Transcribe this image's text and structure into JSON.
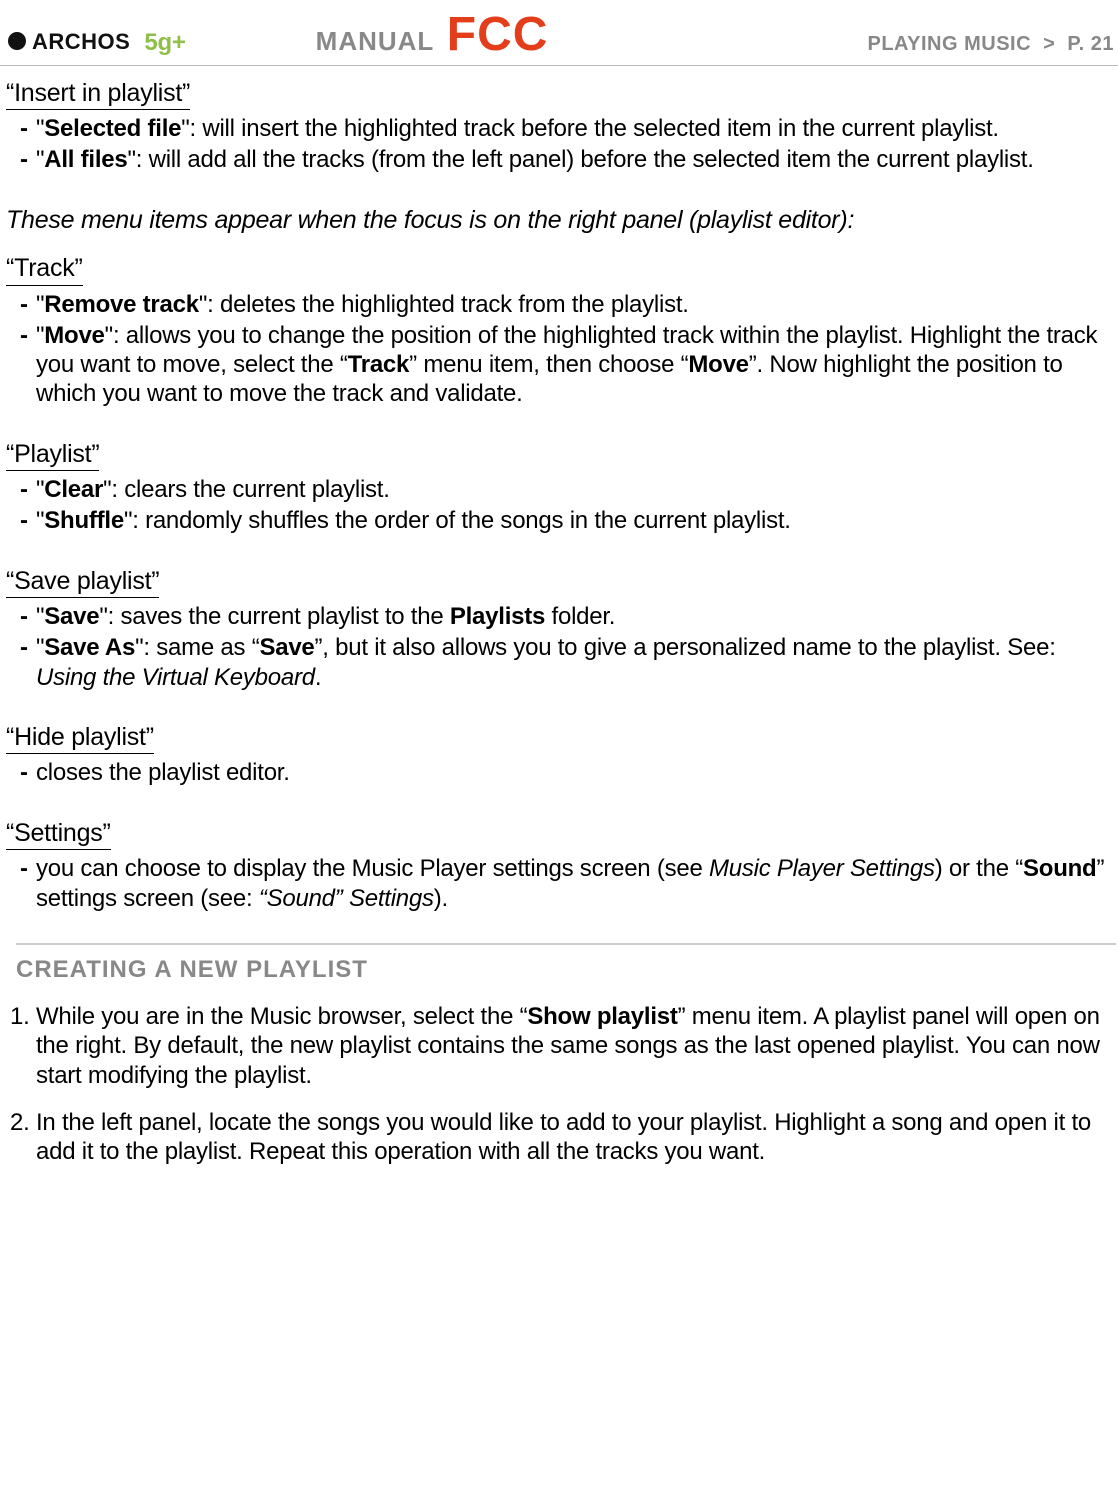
{
  "header": {
    "brand": "ARCHOS",
    "model": "5g+",
    "manual": "MANUAL",
    "fcc": "FCC",
    "section_label": "PLAYING MUSIC",
    "separator": ">",
    "page_label": "P. 21"
  },
  "sections": {
    "insert_in_playlist": {
      "title": "“Insert in playlist”",
      "items": [
        {
          "term": "Selected file",
          "desc": ": will insert the highlighted track before the selected item in the current playlist."
        },
        {
          "term": "All files",
          "desc": ": will add all the tracks (from the left panel) before the selected item the current playlist."
        }
      ]
    },
    "note": "These menu items appear when the focus is on the right panel (playlist editor):",
    "track": {
      "title": "“Track”",
      "items": [
        {
          "term": "Remove track",
          "desc": ": deletes the highlighted track from the playlist."
        },
        {
          "term": "Move",
          "desc_pre": ": allows you to change the position of the highlighted track within the playlist. Highlight the track you want to move, select the “",
          "bold1": "Track",
          "desc_mid": "” menu item, then choose “",
          "bold2": "Move",
          "desc_post": "”. Now highlight the position to which you want to move the track and validate."
        }
      ]
    },
    "playlist": {
      "title": "“Playlist”",
      "items": [
        {
          "term": "Clear",
          "desc": ": clears the current playlist."
        },
        {
          "term": "Shuffle",
          "desc": ": randomly shuffles the order of the songs in the current playlist."
        }
      ]
    },
    "save_playlist": {
      "title": "“Save playlist”",
      "items": [
        {
          "term": "Save",
          "desc_pre": ": saves the current playlist to the ",
          "bold1": "Playlists",
          "desc_post": " folder."
        },
        {
          "term": "Save As",
          "desc_pre": ": same as “",
          "bold1": "Save",
          "desc_mid": "”, but it also allows you to give a personalized name to the playlist. See: ",
          "italic1": "Using the Virtual Keyboard",
          "desc_post": "."
        }
      ]
    },
    "hide_playlist": {
      "title": "“Hide playlist”",
      "items": [
        {
          "plain": "closes the playlist editor."
        }
      ]
    },
    "settings": {
      "title": "“Settings”",
      "items": [
        {
          "plain_pre": "you can choose to display the Music Player settings screen (see ",
          "italic1": "Music Player Settings",
          "mid": ") or the “",
          "bold1": "Sound",
          "mid2": "” settings screen (see: ",
          "italic2": "“Sound” Settings",
          "plain_post": ")."
        }
      ]
    }
  },
  "subheader": "CREATING A NEW PLAYLIST",
  "steps": [
    {
      "pre": "While you are in the Music browser, select the “",
      "bold1": "Show playlist",
      "post": "” menu item. A playlist panel will open on the right. By default, the new playlist contains the same songs as the last opened playlist. You can now start modifying the playlist."
    },
    {
      "plain": "In the left panel, locate the songs you would like to add to your playlist. Highlight a song and open it to add it to the playlist. Repeat this operation with all the tracks you want."
    }
  ]
}
